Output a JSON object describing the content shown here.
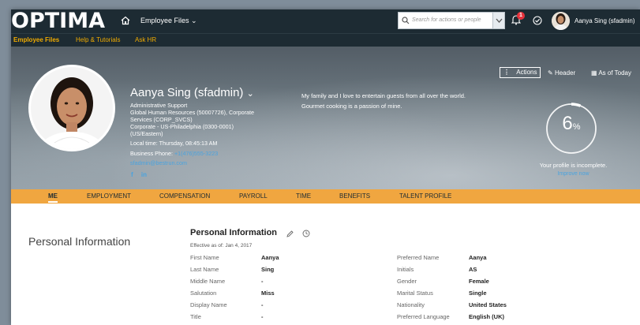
{
  "shell": {
    "logo": "OPTIMA",
    "app_name": "Employee Files ⌄",
    "search_placeholder": "Search for actions or people",
    "notification_count": "1",
    "user_name": "Aanya Sing (sfadmin)",
    "icons": [
      "home-icon",
      "search-icon",
      "chevron-down-icon",
      "bell-icon",
      "todo-icon"
    ]
  },
  "subnav": {
    "items": [
      "Employee Files",
      "Help & Tutorials",
      "Ask HR"
    ],
    "active": "Employee Files"
  },
  "header": {
    "name": "Aanya Sing (sfadmin)",
    "job_title": "Administrative Support",
    "department_line1": "Global Human Resources (50007726), Corporate",
    "department_line2": "Services (CORP_SVCS)",
    "location_line1": "Corporate - US-Philadelphia (0300-0001)",
    "location_line2": "(US/Eastern)",
    "local_time": "Local time: Thursday, 08:45:13 AM",
    "business_phone_label": "Business Phone:",
    "business_phone": "+1(476)555-3223",
    "email": "sfadmin@bestrun.com",
    "about": "My family and I love to entertain guests from all over the world. Gourmet cooking is a passion of mine.",
    "actions_label": "Actions",
    "header_label": "Header",
    "as_of_label": "As of Today",
    "profile_percent": "6",
    "percent_sign": "%",
    "profile_complete_fraction": 0.06,
    "profile_status": "Your profile is incomplete.",
    "improve_link": "Improve now",
    "social": [
      "f",
      "in"
    ],
    "accent_color": "#f0a640",
    "link_color": "#4aa3df"
  },
  "tabs": [
    "ME",
    "EMPLOYMENT",
    "COMPENSATION",
    "PAYROLL",
    "TIME",
    "BENEFITS",
    "TALENT PROFILE"
  ],
  "active_tab": "ME",
  "personal": {
    "section_title": "Personal Information",
    "card_title": "Personal Information",
    "effective": "Effective as of: Jan 4, 2017",
    "left_fields": [
      {
        "label": "First Name",
        "value": "Aanya"
      },
      {
        "label": "Last Name",
        "value": "Sing"
      },
      {
        "label": "Middle Name",
        "value": "-"
      },
      {
        "label": "Salutation",
        "value": "Miss"
      },
      {
        "label": "Display Name",
        "value": "-"
      },
      {
        "label": "Title",
        "value": "-"
      }
    ],
    "right_fields": [
      {
        "label": "Preferred Name",
        "value": "Aanya"
      },
      {
        "label": "Initials",
        "value": "AS"
      },
      {
        "label": "Gender",
        "value": "Female"
      },
      {
        "label": "Marital Status",
        "value": "Single"
      },
      {
        "label": "Nationality",
        "value": "United States"
      },
      {
        "label": "Preferred Language",
        "value": "English (UK)"
      }
    ]
  }
}
